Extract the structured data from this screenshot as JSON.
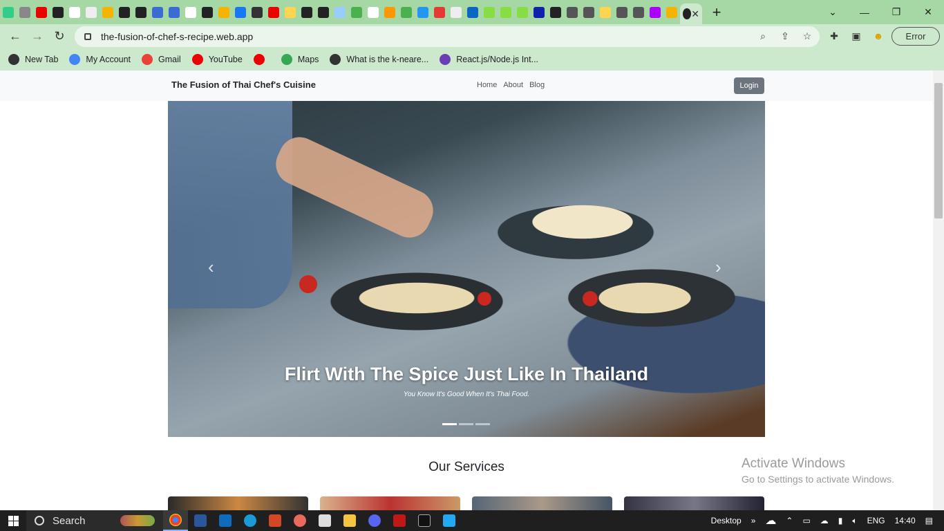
{
  "browser": {
    "tab_favicons": [
      "#3c8",
      "#888",
      "#e00",
      "#222",
      "#fff",
      "#eee",
      "#f4b400",
      "#222",
      "#222",
      "#3b6cd4",
      "#3b6cd4",
      "#fff",
      "#222",
      "#f4b400",
      "#1877f2",
      "#333",
      "#e00",
      "#ffd54f",
      "#222",
      "#222",
      "#9cf",
      "#4caf50",
      "#fff",
      "#ff9800",
      "#4caf50",
      "#2196f3",
      "#e53935",
      "#eee",
      "#0a66c2",
      "#8d4",
      "#8d4",
      "#8d4",
      "#12a",
      "#222",
      "#555",
      "#555",
      "#ffd54f",
      "#555",
      "#555",
      "#a0f",
      "#f4b400"
    ],
    "new_tab_symbol": "+",
    "url": "the-fusion-of-chef-s-recipe.web.app",
    "profile_status": "Error",
    "bookmarks": [
      {
        "label": "New Tab",
        "color": "#333"
      },
      {
        "label": "My Account",
        "color": "#4285f4"
      },
      {
        "label": "Gmail",
        "color": "#ea4335"
      },
      {
        "label": "YouTube",
        "color": "#e00"
      },
      {
        "label": "",
        "color": "#e00"
      },
      {
        "label": "Maps",
        "color": "#34a853"
      },
      {
        "label": "What is the k-neare...",
        "color": "#333"
      },
      {
        "label": "React.js/Node.js Int...",
        "color": "#6a3fb5"
      }
    ]
  },
  "site": {
    "brand": "The Fusion of Thai Chef's Cuisine",
    "nav": [
      "Home",
      "About",
      "Blog"
    ],
    "login_label": "Login",
    "carousel": {
      "title": "Flirt With The Spice Just Like In Thailand",
      "subtitle": "You Know It's Good When It's Thai Food.",
      "prev_symbol": "‹",
      "next_symbol": "›",
      "slide_count": 3,
      "active_slide": 1
    },
    "services_title": "Our Services"
  },
  "watermark": {
    "line1": "Activate Windows",
    "line2": "Go to Settings to activate Windows."
  },
  "taskbar": {
    "search_label": "Search",
    "desktop_label": "Desktop",
    "lang": "ENG",
    "time": "14:40"
  }
}
